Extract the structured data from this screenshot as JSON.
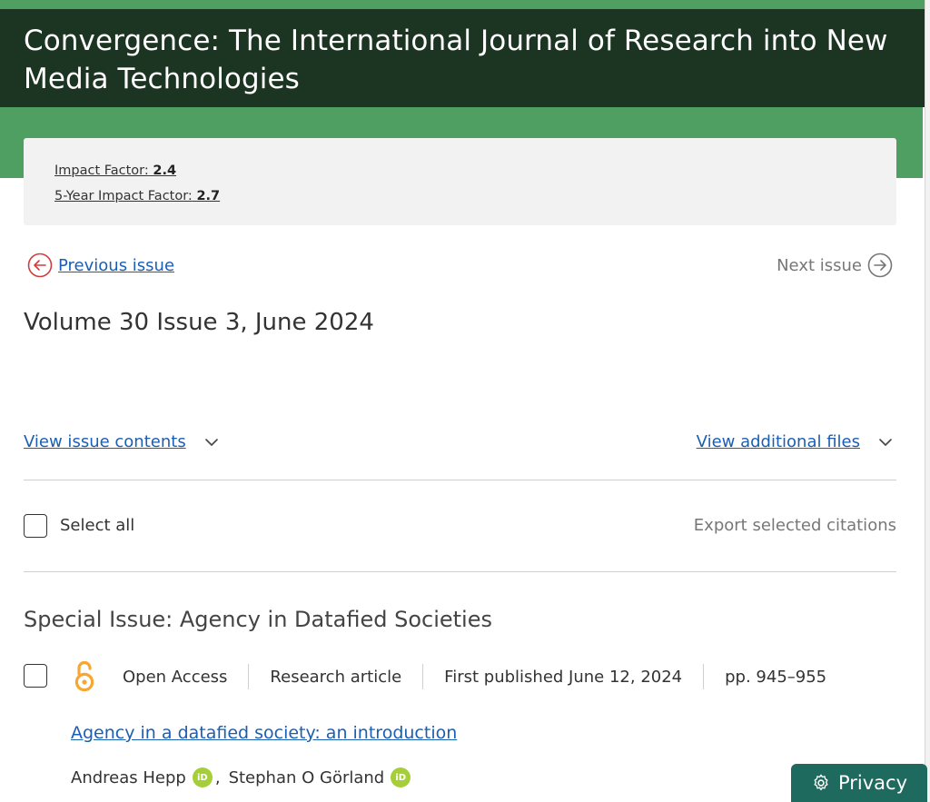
{
  "journal": {
    "title": "Convergence: The International Journal of Research into New Media Technologies"
  },
  "metrics": {
    "impact_factor_label": "Impact Factor:",
    "impact_factor_value": "2.4",
    "five_year_label": "5-Year Impact Factor:",
    "five_year_value": "2.7"
  },
  "nav": {
    "previous_label": "Previous issue",
    "next_label": "Next issue"
  },
  "issue": {
    "volume_title": "Volume 30 Issue 3, June 2024"
  },
  "toggles": {
    "contents_label": "View issue contents",
    "files_label": "View additional files"
  },
  "selection": {
    "select_all_label": "Select all",
    "export_label": "Export selected citations"
  },
  "section": {
    "heading": "Special Issue: Agency in Datafied Societies"
  },
  "article": {
    "access": "Open Access",
    "type": "Research article",
    "published": "First published June 12, 2024",
    "pages": "pp. 945–955",
    "title": "Agency in a datafied society: an introduction",
    "authors": [
      {
        "name": "Andreas Hepp"
      },
      {
        "name": "Stephan O Görland"
      }
    ],
    "author_separator": ",",
    "orcid_badge": "iD"
  },
  "privacy": {
    "label": "Privacy"
  },
  "colors": {
    "header_bg": "#1c3422",
    "accent_green": "#4f9e62",
    "link_blue": "#1a5fb4",
    "open_access_orange": "#f7a731",
    "orcid_green": "#a6ce39",
    "privacy_bg": "#1f6a5e",
    "prev_arrow_red": "#d23c3c"
  },
  "icons": {
    "previous": "circle-arrow-left-icon",
    "next": "circle-arrow-right-icon",
    "expand": "chevron-down-icon",
    "open_access": "open-access-lock-icon",
    "orcid": "orcid-icon",
    "privacy": "gear-icon"
  }
}
